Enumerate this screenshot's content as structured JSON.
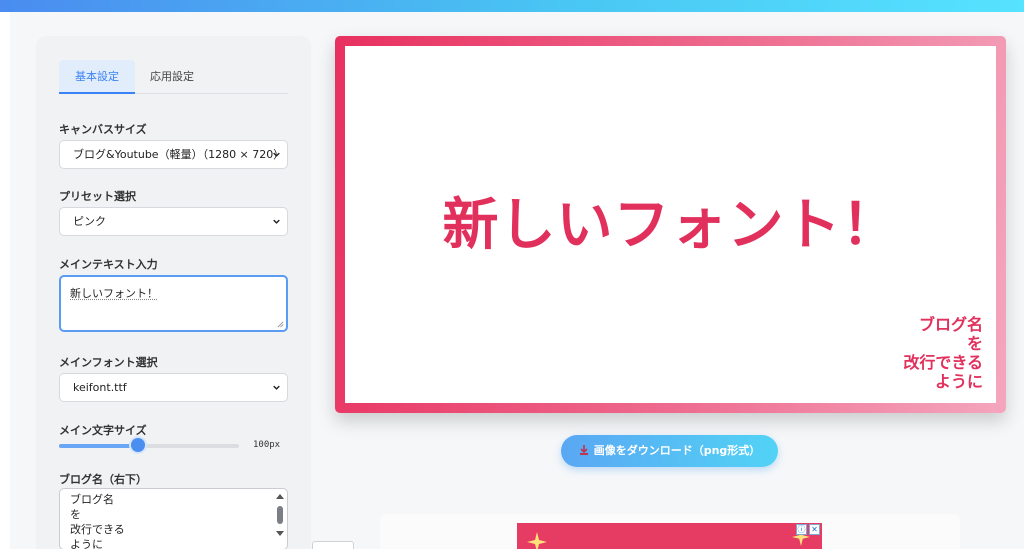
{
  "tabs": [
    {
      "label": "基本設定",
      "active": true
    },
    {
      "label": "応用設定",
      "active": false
    }
  ],
  "canvas_size": {
    "label": "キャンバスサイズ",
    "selected": "ブログ&Youtube（軽量）（1280 × 720）"
  },
  "preset": {
    "label": "プリセット選択",
    "selected": "ピンク"
  },
  "main_text_input": {
    "label": "メインテキスト入力",
    "value": "新しいフォント！"
  },
  "main_font": {
    "label": "メインフォント選択",
    "selected": "keifont.ttf"
  },
  "main_font_size": {
    "label": "メイン文字サイズ",
    "value_text": "100px",
    "level": 0.44
  },
  "blog_name_input": {
    "label": "ブログ名（右下）",
    "lines": [
      "ブログ名",
      "を",
      "改行できる",
      "ように"
    ]
  },
  "preview": {
    "main_text": "新しいフォント！",
    "blog_lines": [
      "ブログ名",
      "を",
      "改行できる",
      "ように"
    ]
  },
  "download_button": {
    "label": "画像をダウンロード（png形式）"
  },
  "ad_icons": [
    "ⓘ",
    "✕"
  ],
  "colors": {
    "accent": "#3b82f6",
    "preview_text": "#e2305c",
    "frame_start": "#e8305f",
    "frame_end": "#f4a6be"
  }
}
